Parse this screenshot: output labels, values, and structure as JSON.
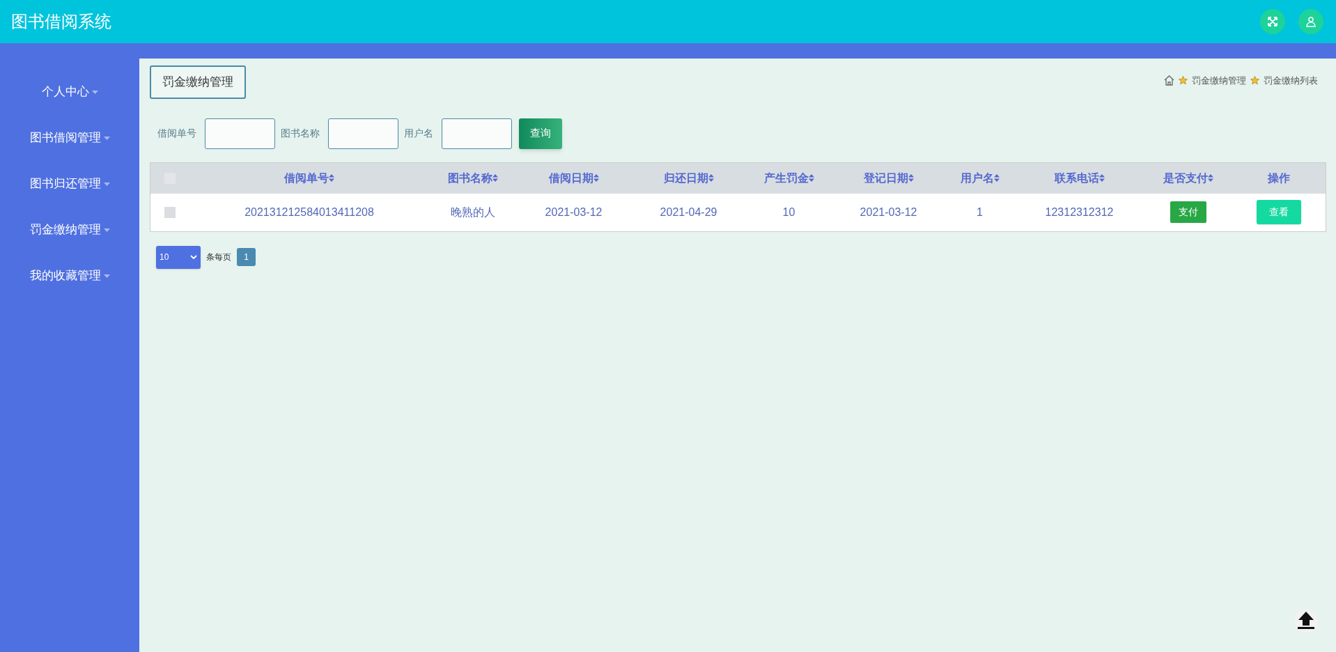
{
  "header": {
    "title": "图书借阅系统"
  },
  "sidebar": {
    "items": [
      {
        "label": "个人中心"
      },
      {
        "label": "图书借阅管理"
      },
      {
        "label": "图书归还管理"
      },
      {
        "label": "罚金缴纳管理"
      },
      {
        "label": "我的收藏管理"
      }
    ]
  },
  "page_title": "罚金缴纳管理",
  "breadcrumb": [
    "罚金缴纳管理",
    "罚金缴纳列表"
  ],
  "search": {
    "fields": [
      {
        "label": "借阅单号"
      },
      {
        "label": "图书名称"
      },
      {
        "label": "用户名"
      }
    ],
    "button": "查询"
  },
  "table": {
    "columns": [
      {
        "label": "借阅单号",
        "sortable": true
      },
      {
        "label": "图书名称",
        "sortable": true
      },
      {
        "label": "借阅日期",
        "sortable": true
      },
      {
        "label": "归还日期",
        "sortable": true
      },
      {
        "label": "产生罚金",
        "sortable": true
      },
      {
        "label": "登记日期",
        "sortable": true
      },
      {
        "label": "用户名",
        "sortable": true
      },
      {
        "label": "联系电话",
        "sortable": true
      },
      {
        "label": "是否支付",
        "sortable": true
      },
      {
        "label": "操作",
        "sortable": false
      }
    ],
    "select_all_checked": false,
    "rows": [
      {
        "checked": false,
        "cells": [
          "202131212584013411208",
          "晚熟的人",
          "2021-03-12",
          "2021-04-29",
          "10",
          "2021-03-12",
          "1",
          "12312312312"
        ],
        "pay_button": "支付",
        "view_button": "查看"
      }
    ]
  },
  "pagination": {
    "page_size": "10",
    "per_page_label": "条每页",
    "pages": [
      {
        "label": "1",
        "selected": true
      }
    ]
  }
}
